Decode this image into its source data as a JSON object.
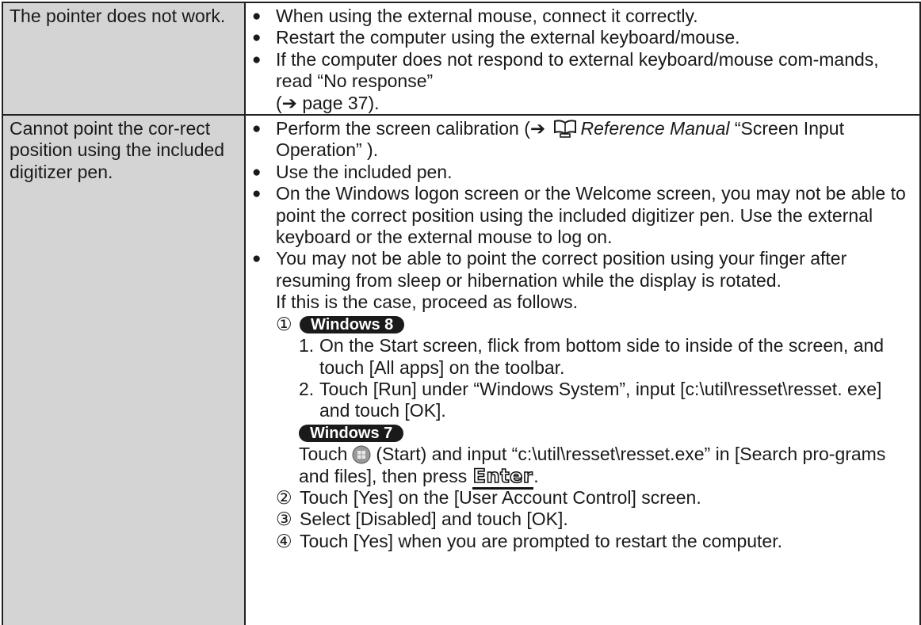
{
  "rows": [
    {
      "problem": "The pointer does not work.",
      "remedies": [
        "When using the external mouse, connect it correctly.",
        "Restart the computer using the external keyboard/mouse.",
        "If the computer does not respond to external keyboard/mouse com-mands, read “No response”"
      ],
      "see": "(➔ page 37)."
    },
    {
      "problem": "Cannot point the cor-rect position using the included digitizer pen.",
      "calibration": {
        "before": "Perform the screen calibration (➔ ",
        "manual": "Reference Manual",
        "after": " “Screen Input Operation” )."
      },
      "use_pen": "Use the included pen.",
      "logon": "On the Windows logon screen or the Welcome screen, you may not be able to point the correct position using the included digitizer pen. Use the external keyboard or the external mouse to log on.",
      "finger": "You may not be able to point the correct position using your finger after resuming from sleep or hibernation while the display is rotated.",
      "proceed": "If this is the case, proceed as follows.",
      "steps": {
        "s1_num": "①",
        "win8_label": "Windows 8",
        "win8_1_num": "1.",
        "win8_1": "On the Start screen, flick from bottom side to inside of the screen, and touch [All apps] on the toolbar.",
        "win8_2_num": "2.",
        "win8_2": "Touch [Run] under “Windows System”, input [c:\\util\\resset\\resset. exe] and touch [OK].",
        "win7_label": "Windows 7",
        "win7_a": "Touch",
        "win7_b": "(Start) and input “c:\\util\\resset\\resset.exe” in [Search pro-grams and files], then press",
        "enter_key": "Enter",
        "win7_end": ".",
        "s2_num": "②",
        "s2": "Touch [Yes] on the [User Account Control] screen.",
        "s3_num": "③",
        "s3": "Select [Disabled] and touch [OK].",
        "s4_num": "④",
        "s4": "Touch [Yes] when you are prompted to restart the computer."
      }
    }
  ],
  "bullet": "●"
}
